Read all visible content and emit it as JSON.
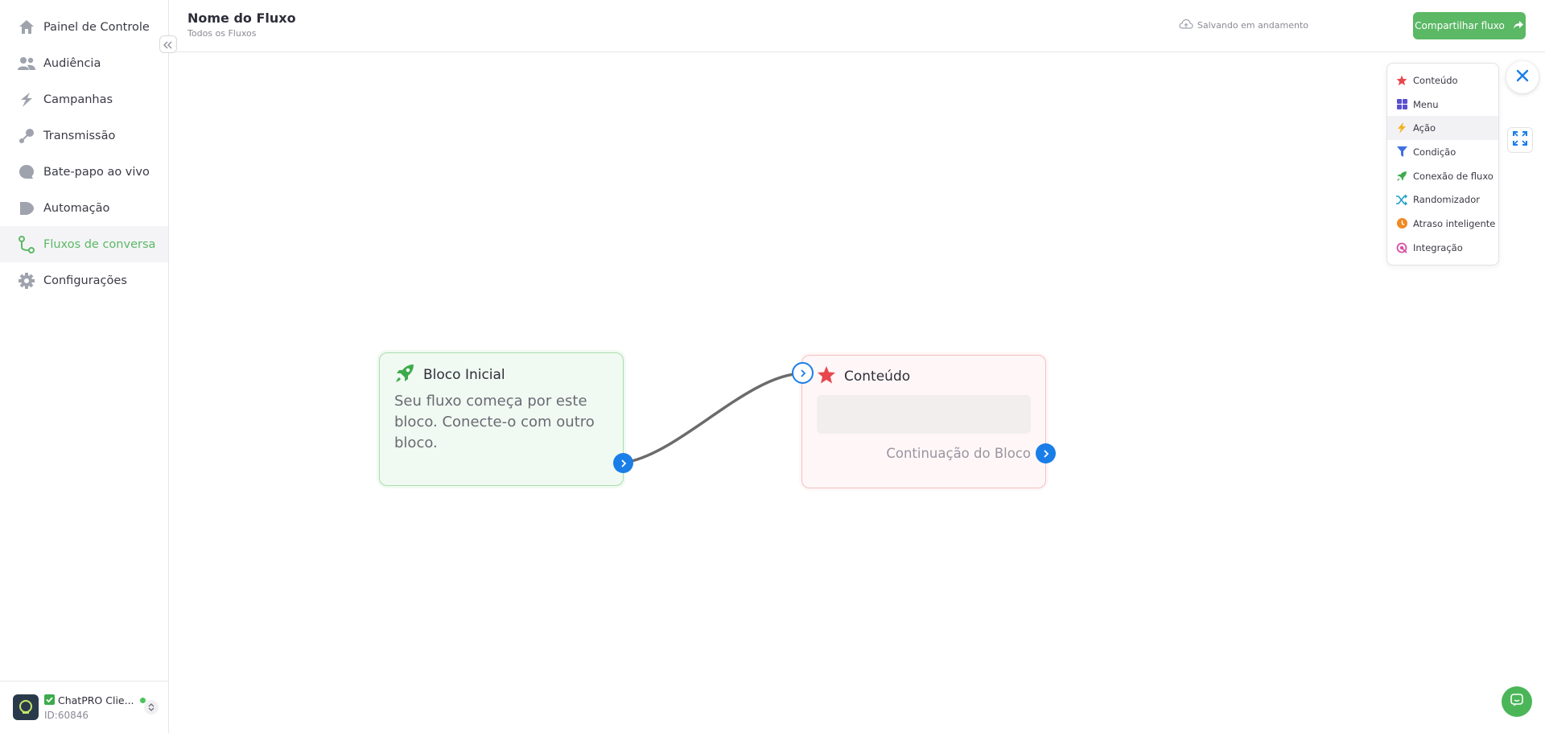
{
  "sidebar": {
    "items": [
      {
        "label": "Painel de Controle",
        "icon": "home-icon"
      },
      {
        "label": "Audiência",
        "icon": "users-icon"
      },
      {
        "label": "Campanhas",
        "icon": "campaigns-icon"
      },
      {
        "label": "Transmissão",
        "icon": "broadcast-icon"
      },
      {
        "label": "Bate-papo ao vivo",
        "icon": "chat-bubble-icon"
      },
      {
        "label": "Automação",
        "icon": "automation-icon"
      },
      {
        "label": "Fluxos de conversa",
        "icon": "flow-icon",
        "active": true
      },
      {
        "label": "Configurações",
        "icon": "gear-icon"
      }
    ],
    "account": {
      "name": "ChatPRO Clie...",
      "id": "ID:60846"
    }
  },
  "header": {
    "title": "Nome do Fluxo",
    "breadcrumb": "Todos os Fluxos",
    "save_status": "Salvando em andamento",
    "share_label": "Compartilhar fluxo"
  },
  "canvas": {
    "start_block": {
      "title": "Bloco Inicial",
      "description": "Seu fluxo começa por este bloco. Conecte-o com outro bloco."
    },
    "content_block": {
      "title": "Conteúdo",
      "continue_label": "Continuação do Bloco"
    }
  },
  "add_menu": {
    "items": [
      {
        "label": "Conteúdo",
        "icon": "star-icon",
        "color": "#e8474e"
      },
      {
        "label": "Menu",
        "icon": "grid-icon",
        "color": "#5a4fcf"
      },
      {
        "label": "Ação",
        "icon": "lightning-icon",
        "color": "#f2b21b",
        "highlighted": true
      },
      {
        "label": "Condição",
        "icon": "filter-icon",
        "color": "#3f6fe0"
      },
      {
        "label": "Conexão de fluxo",
        "icon": "rocket-icon",
        "color": "#3dab4d"
      },
      {
        "label": "Randomizador",
        "icon": "shuffle-icon",
        "color": "#1f9fc4"
      },
      {
        "label": "Atraso inteligente",
        "icon": "clock-icon",
        "color": "#f08a24"
      },
      {
        "label": "Integração",
        "icon": "integration-icon",
        "color": "#d94fa5"
      }
    ]
  },
  "colors": {
    "brand": "#5bb865",
    "port": "#1a7ee8",
    "close": "#1a7ee8"
  }
}
